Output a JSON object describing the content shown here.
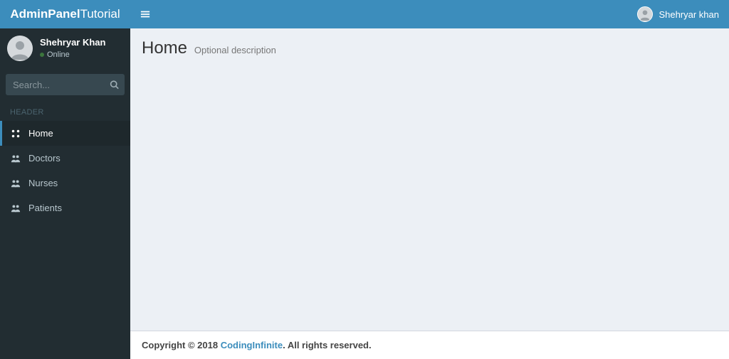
{
  "brand": {
    "bold": "AdminPanel",
    "light": "Tutorial"
  },
  "user": {
    "name": "Shehryar Khan",
    "status": "Online"
  },
  "top_user": {
    "name": "Shehryar khan"
  },
  "search": {
    "placeholder": "Search..."
  },
  "sidebar": {
    "header": "HEADER",
    "items": [
      {
        "label": "Home"
      },
      {
        "label": "Doctors"
      },
      {
        "label": "Nurses"
      },
      {
        "label": "Patients"
      }
    ]
  },
  "page": {
    "title": "Home",
    "subtitle": "Optional description"
  },
  "footer": {
    "prefix": "Copyright © 2018 ",
    "link": "CodingInfinite",
    "suffix": ". All rights reserved."
  }
}
